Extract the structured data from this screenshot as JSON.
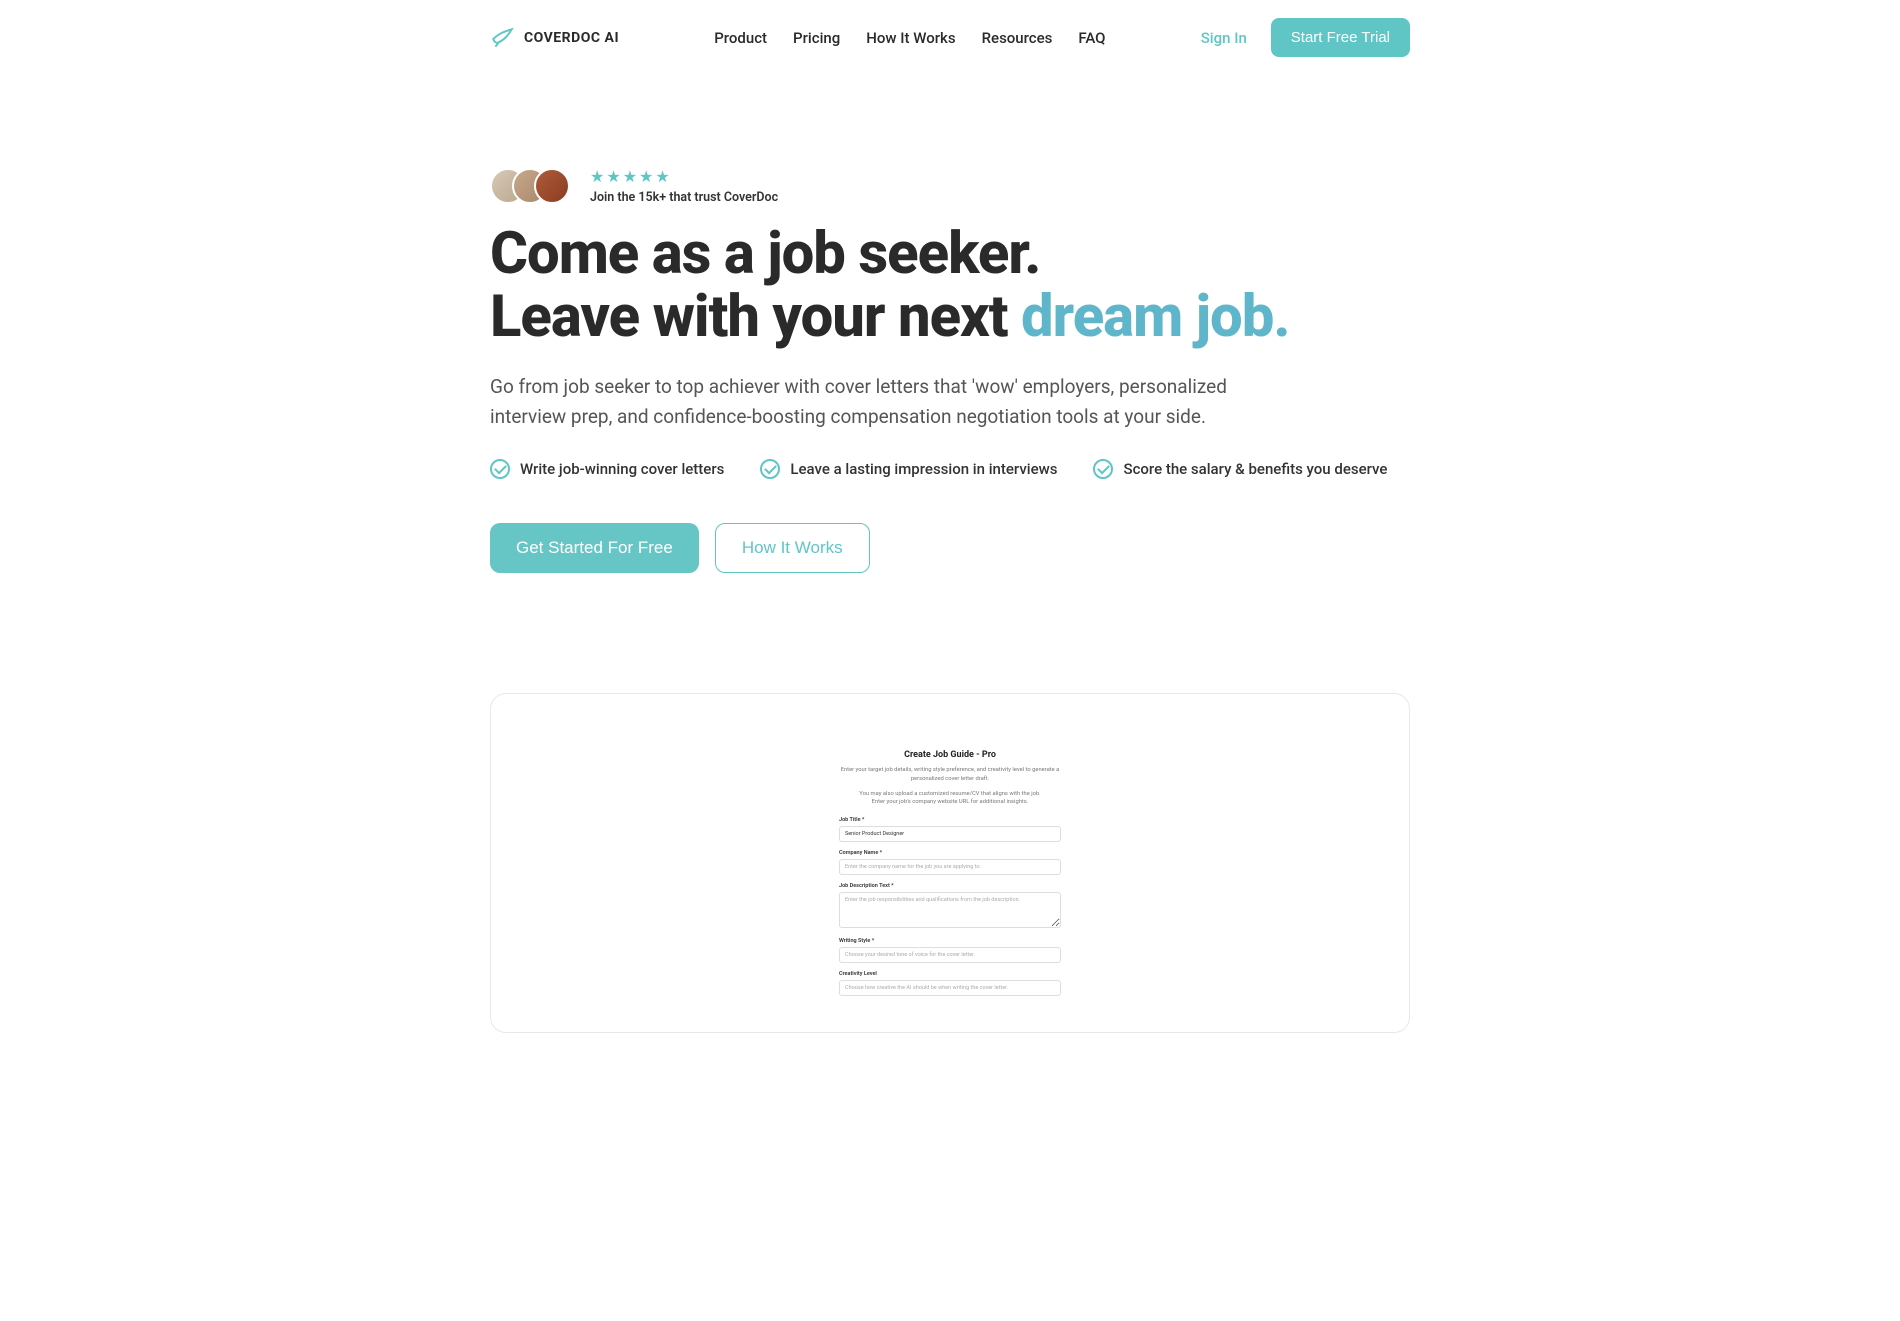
{
  "brand": "COVERDOC AI",
  "nav": {
    "items": [
      "Product",
      "Pricing",
      "How It Works",
      "Resources",
      "FAQ"
    ]
  },
  "header": {
    "signin": "Sign In",
    "cta": "Start Free Trial"
  },
  "social": {
    "trust": "Join the 15k+ that trust CoverDoc"
  },
  "hero": {
    "line1": "Come as a job seeker.",
    "line2a": "Leave with your next ",
    "line2b": "dream job.",
    "sub": "Go from job seeker to top achiever with cover letters that 'wow' employers, personalized interview prep, and confidence-boosting compensation negotiation tools at your side."
  },
  "features": [
    "Write job-winning cover letters",
    "Leave a lasting impression in interviews",
    "Score the salary & benefits you deserve"
  ],
  "cta": {
    "primary": "Get Started For Free",
    "secondary": "How It Works"
  },
  "demo": {
    "title": "Create Job Guide - Pro",
    "desc": "Enter your target job details, writing style preference, and creativity level to generate a personalized cover letter draft.",
    "note1": "You may also upload a customized resume/CV that aligns with the job.",
    "note2": "Enter your job's company website URL for additional insights.",
    "fields": {
      "jobTitle": {
        "label": "Job Title *",
        "value": "Senior Product Designer"
      },
      "companyName": {
        "label": "Company Name *",
        "placeholder": "Enter the company name for the job you are applying to."
      },
      "jobDesc": {
        "label": "Job Description Text *",
        "placeholder": "Enter the job responsibilities and qualifications from the job description."
      },
      "writingStyle": {
        "label": "Writing Style *",
        "placeholder": "Choose your desired tone of voice for the cover letter."
      },
      "creativity": {
        "label": "Creativity Level",
        "placeholder": "Choose how creative the AI should be when writing the cover letter."
      }
    }
  }
}
